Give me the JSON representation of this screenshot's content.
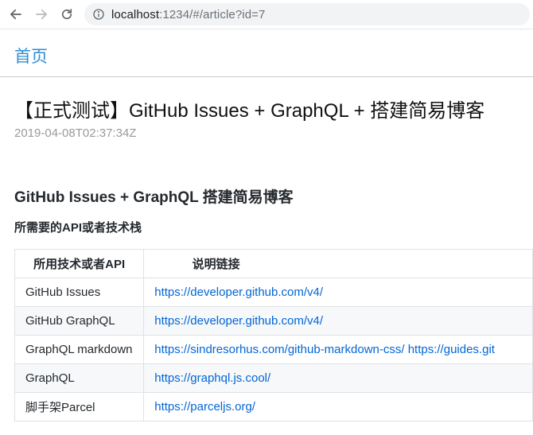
{
  "browser": {
    "url_host": "localhost",
    "url_rest": ":1234/#/article?id=7"
  },
  "header": {
    "home_label": "首页"
  },
  "article": {
    "title": "【正式测试】GitHub Issues + GraphQL + 搭建简易博客",
    "date": "2019-04-08T02:37:34Z",
    "heading": "GitHub Issues + GraphQL 搭建简易博客",
    "subheading": "所需要的API或者技术栈",
    "table": {
      "headers": [
        "所用技术或者API",
        "说明链接"
      ],
      "rows": [
        {
          "tech": "GitHub Issues",
          "link": "https://developer.github.com/v4/"
        },
        {
          "tech": "GitHub GraphQL",
          "link": "https://developer.github.com/v4/"
        },
        {
          "tech": "GraphQL markdown",
          "link": "https://sindresorhus.com/github-markdown-css/ https://guides.git"
        },
        {
          "tech": "GraphQL",
          "link": "https://graphql.js.cool/"
        },
        {
          "tech": "脚手架Parcel",
          "link": "https://parceljs.org/"
        }
      ]
    }
  },
  "icons": {
    "back": "arrow-left-icon",
    "forward": "arrow-right-icon",
    "reload": "reload-icon",
    "info": "info-circle-icon"
  }
}
